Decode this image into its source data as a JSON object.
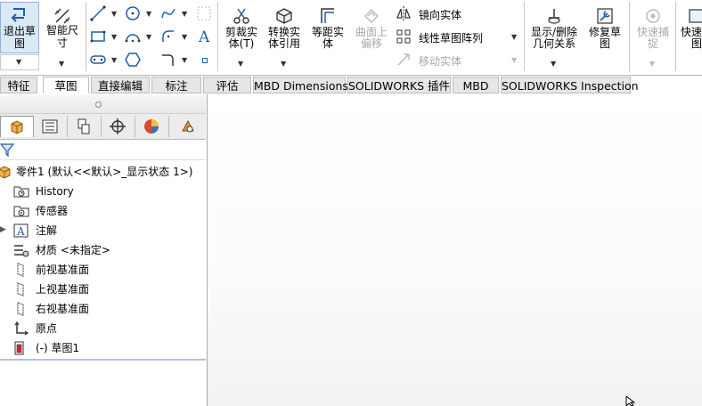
{
  "ribbon": {
    "exit_sketch": {
      "line1": "退出草",
      "line2": "图"
    },
    "smart_dim": {
      "line1": "智能尺",
      "line2": "寸"
    },
    "trim": {
      "line1": "剪裁实",
      "line2": "体(T)"
    },
    "convert": {
      "line1": "转换实",
      "line2": "体引用"
    },
    "offset": {
      "line1": "等距实",
      "line2": "体"
    },
    "surface_offset": {
      "line1": "曲面上",
      "line2": "偏移"
    },
    "mirror": "镜向实体",
    "linear_pattern": "线性草图阵列",
    "move": "移动实体",
    "show_relations": {
      "line1": "显示/删除",
      "line2": "几何关系"
    },
    "repair": {
      "line1": "修复草",
      "line2": "图"
    },
    "quick_snap": {
      "line1": "快速捕",
      "line2": "捉"
    },
    "quick_view": {
      "line1": "快速",
      "line2": "图"
    }
  },
  "tabs": [
    "特征",
    "草图",
    "直接编辑",
    "标注",
    "评估",
    "MBD Dimensions",
    "SOLIDWORKS 插件",
    "MBD",
    "SOLIDWORKS Inspection"
  ],
  "active_tab": "草图",
  "tree": {
    "root": "零件1  (默认<<默认>_显示状态 1>)",
    "items": [
      "History",
      "传感器",
      "注解",
      "材质 <未指定>",
      "前视基准面",
      "上视基准面",
      "右视基准面",
      "原点",
      "(-) 草图1"
    ]
  },
  "colors": {
    "accent": "#1f5fa8",
    "tab_bg": "#e6e6e6",
    "active_tab_bg": "#ffffff"
  }
}
